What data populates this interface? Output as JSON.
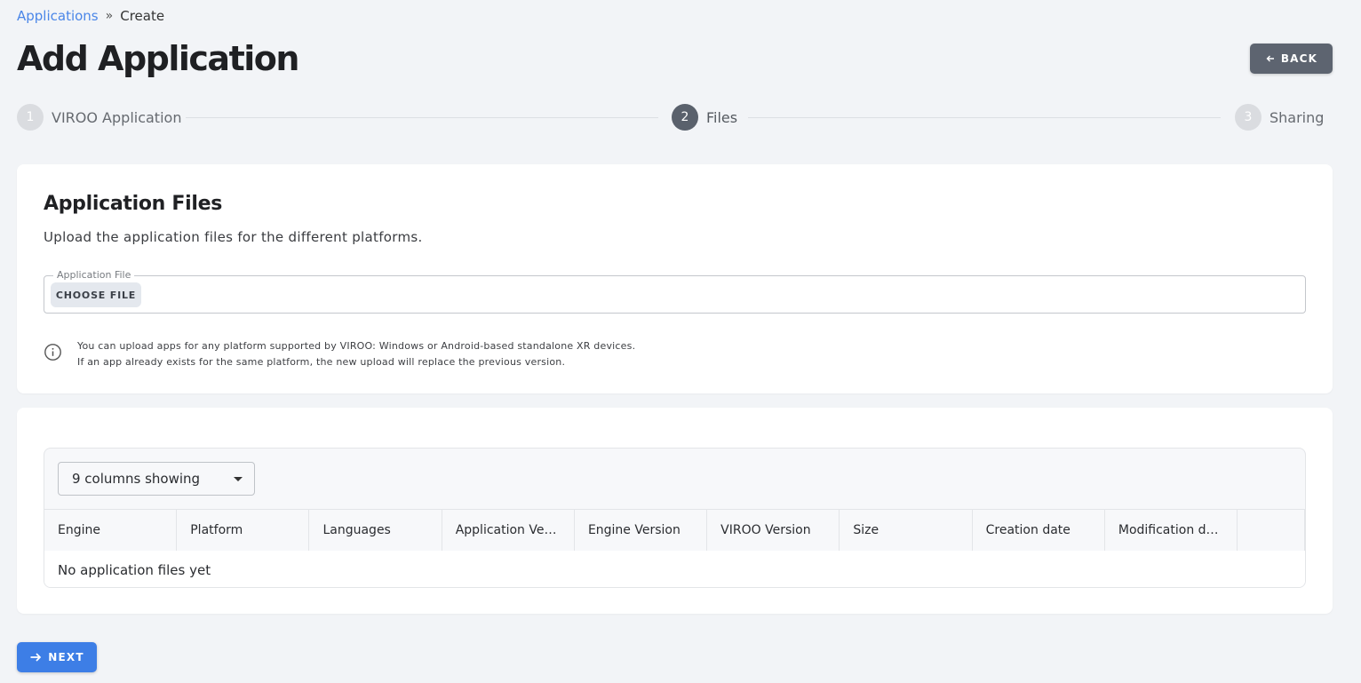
{
  "breadcrumb": {
    "parent": "Applications",
    "separator": "»",
    "current": "Create"
  },
  "page_title": "Add Application",
  "back_button": {
    "label": "BACK",
    "icon": "arrow-left-icon"
  },
  "stepper": {
    "steps": [
      {
        "number": "1",
        "label": "VIROO Application",
        "state": "inactive"
      },
      {
        "number": "2",
        "label": "Files",
        "state": "active"
      },
      {
        "number": "3",
        "label": "Sharing",
        "state": "inactive"
      }
    ]
  },
  "files_card": {
    "title": "Application Files",
    "subtitle": "Upload the application files for the different platforms.",
    "file_field_label": "Application File",
    "choose_file_label": "CHOOSE FILE",
    "info_line_1": "You can upload apps for any platform supported by VIROO: Windows or Android-based standalone XR devices.",
    "info_line_2": "If an app already exists for the same platform, the new upload will replace the previous version."
  },
  "table": {
    "columns_selector": "9 columns showing",
    "columns": [
      "Engine",
      "Platform",
      "Languages",
      "Application Ve…",
      "Engine Version",
      "VIROO Version",
      "Size",
      "Creation date",
      "Modification d…"
    ],
    "empty_text": "No application files yet"
  },
  "next_button": {
    "label": "NEXT",
    "icon": "arrow-right-icon"
  },
  "colors": {
    "accent": "#3d7ee6",
    "link": "#4a86e8",
    "step_active": "#5a616c",
    "back_button": "#5d6470"
  }
}
